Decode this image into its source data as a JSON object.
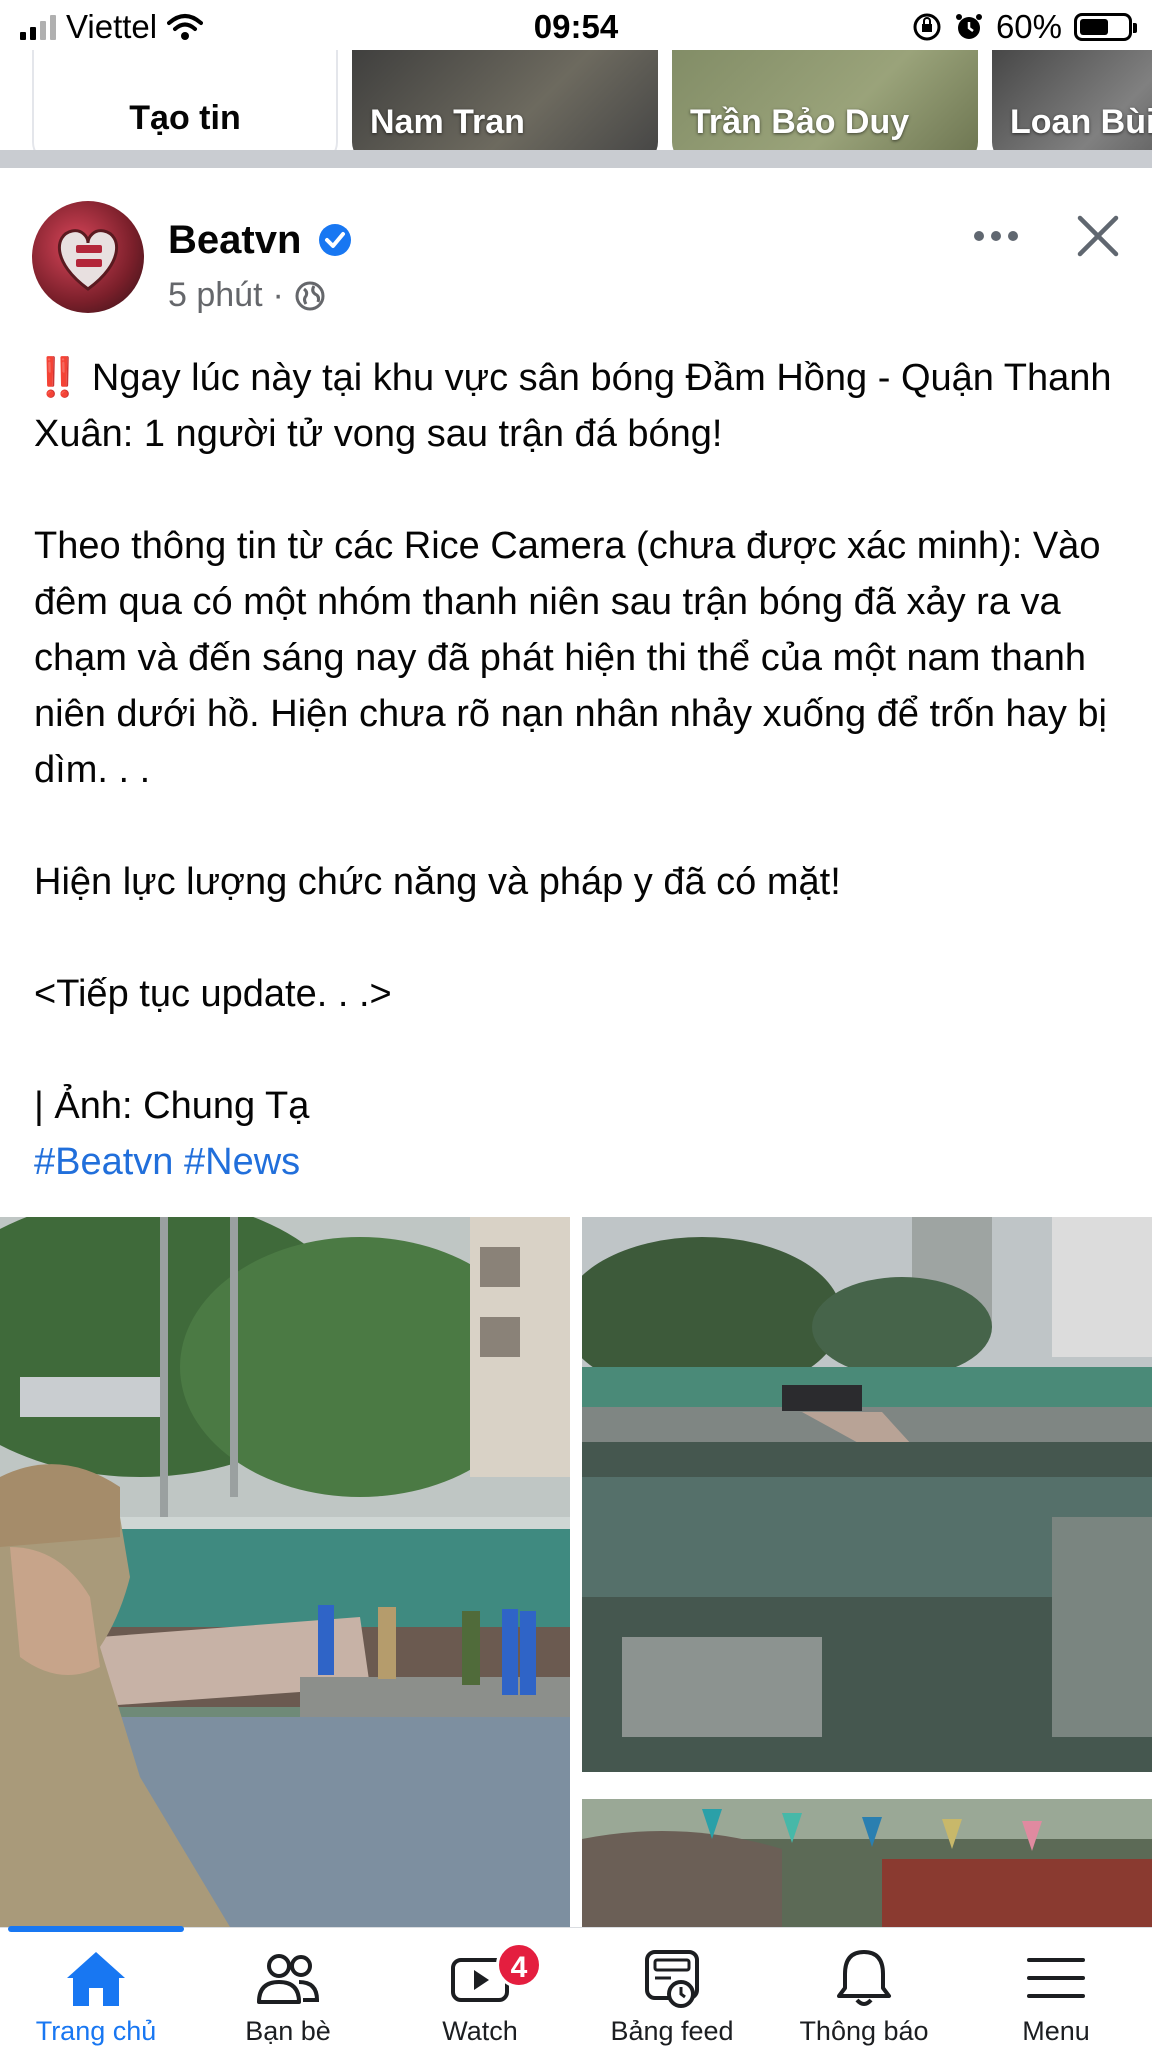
{
  "status_bar": {
    "carrier": "Viettel",
    "time": "09:54",
    "battery": "60%",
    "battery_level": 0.6
  },
  "stories": {
    "create_label": "Tạo tin",
    "items": [
      {
        "name": "Nam Tran"
      },
      {
        "name": "Trần Bảo Duy"
      },
      {
        "name": "Loan Bùi"
      }
    ]
  },
  "post": {
    "page_name": "Beatvn",
    "time": "5 phút",
    "meta_separator": "·",
    "emoji": "‼️",
    "line1": "Ngay lúc này tại khu vực sân bóng Đầm Hồng - Quận Thanh Xuân: 1 người tử vong sau trận đá bóng!",
    "para2": "Theo thông tin từ các Rice Camera (chưa được xác minh): Vào đêm qua có một nhóm thanh niên sau trận bóng đã xảy ra va chạm và đến sáng nay đã phát hiện thi thể của một nam thanh niên dưới hồ. Hiện chưa rõ nạn nhân nhảy xuống để trốn hay bị dìm. . .",
    "para3": "Hiện lực lượng chức năng và pháp y đã có mặt!",
    "para4": "<Tiếp tục update. . .>",
    "credit": "| Ảnh: Chung Tạ",
    "hashtags": [
      "#Beatvn",
      "#News"
    ]
  },
  "bottom_nav": {
    "items": [
      {
        "label": "Trang chủ",
        "icon": "home-icon",
        "active": true
      },
      {
        "label": "Bạn bè",
        "icon": "friends-icon"
      },
      {
        "label": "Watch",
        "icon": "watch-icon",
        "badge": "4"
      },
      {
        "label": "Bảng feed",
        "icon": "feeds-icon"
      },
      {
        "label": "Thông báo",
        "icon": "bell-icon"
      },
      {
        "label": "Menu",
        "icon": "menu-icon"
      }
    ]
  },
  "colors": {
    "accent": "#1877f2",
    "hashtag": "#216fdb",
    "badge": "#e41e3f",
    "verified": "#1877f2"
  }
}
